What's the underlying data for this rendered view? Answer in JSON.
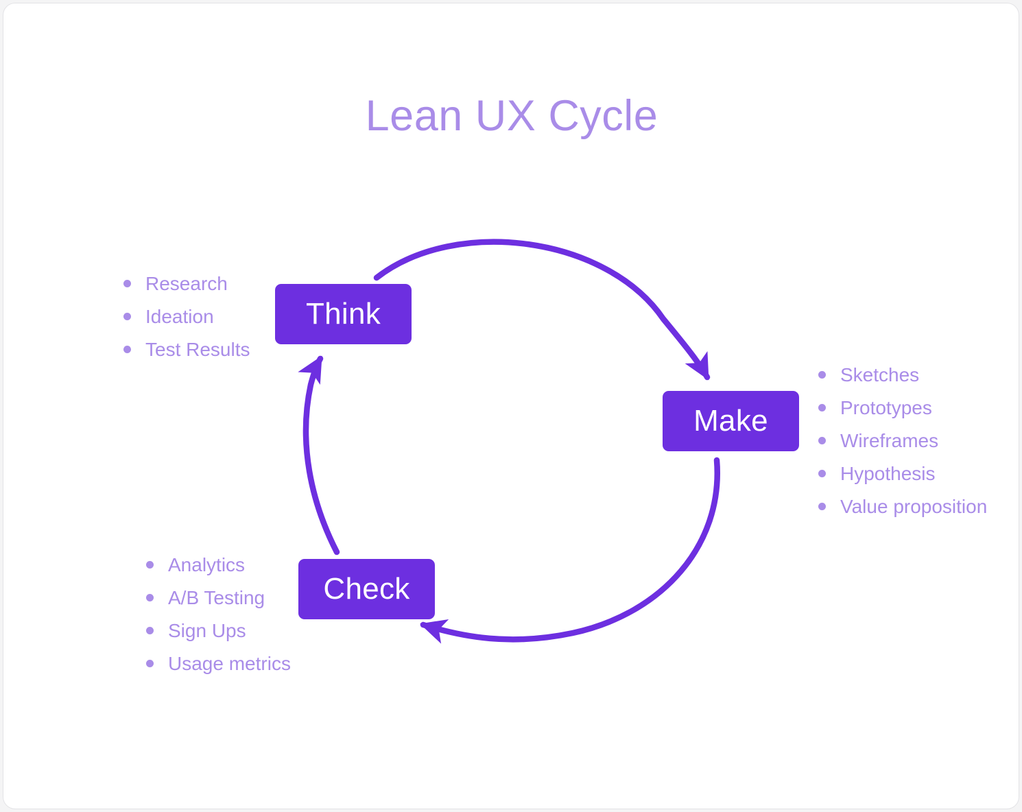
{
  "page": {
    "title": "Lean UX Cycle",
    "accent_color": "#6d2fe0",
    "text_color": "#a98ce8",
    "background_color": "#ffffff"
  },
  "diagram": {
    "type": "cycle",
    "stages": [
      {
        "id": "think",
        "label": "Think",
        "items": [
          "Research",
          "Ideation",
          "Test Results"
        ]
      },
      {
        "id": "make",
        "label": "Make",
        "items": [
          "Sketches",
          "Prototypes",
          "Wireframes",
          "Hypothesis",
          "Value proposition"
        ]
      },
      {
        "id": "check",
        "label": "Check",
        "items": [
          "Analytics",
          "A/B Testing",
          "Sign Ups",
          "Usage metrics"
        ]
      }
    ],
    "arrows": [
      {
        "from": "think",
        "to": "make"
      },
      {
        "from": "make",
        "to": "check"
      },
      {
        "from": "check",
        "to": "think"
      }
    ]
  }
}
